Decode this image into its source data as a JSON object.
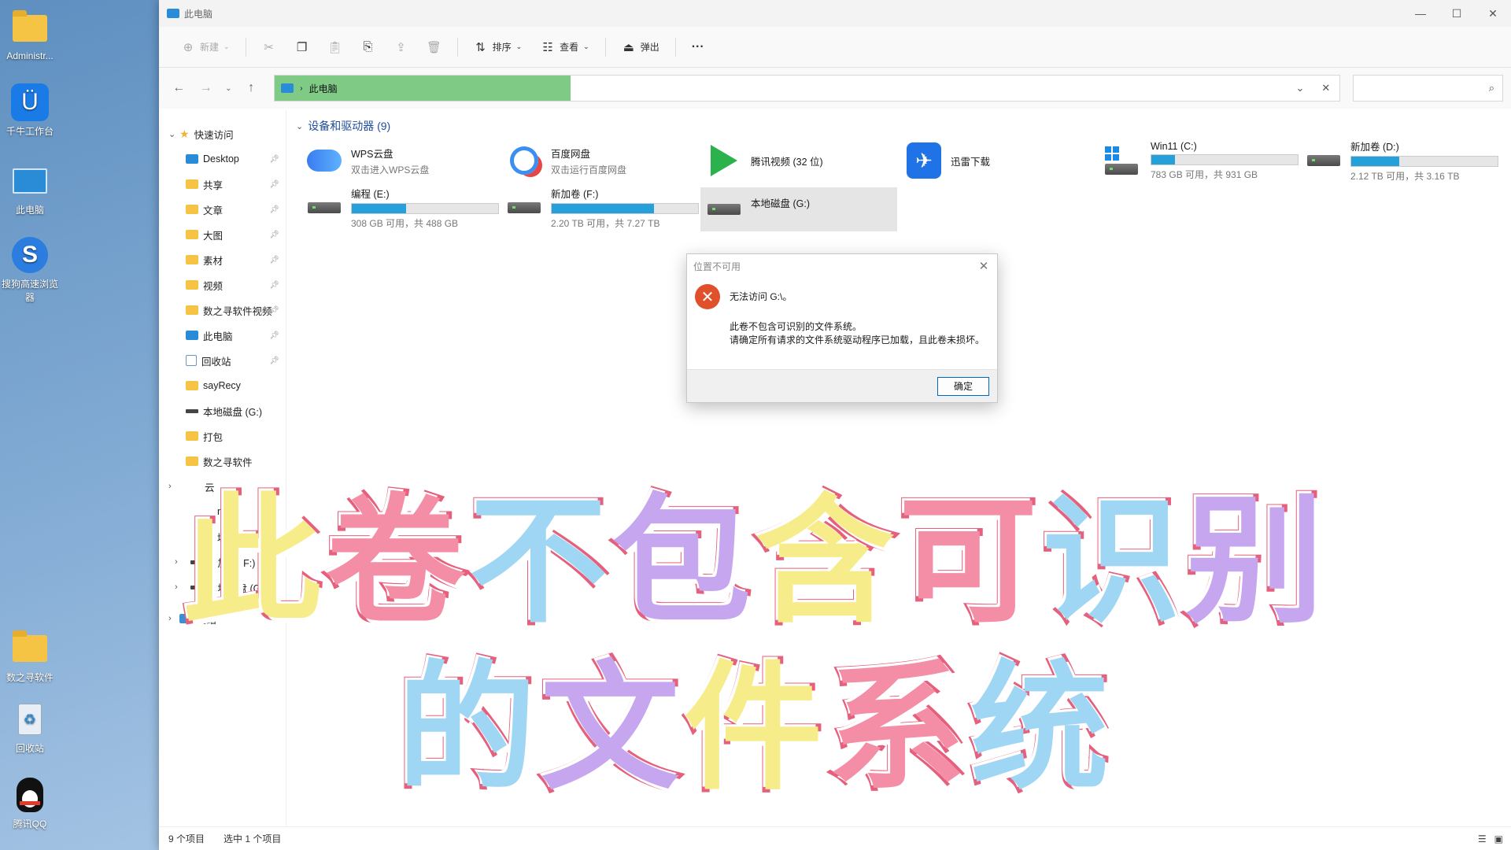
{
  "desktop": {
    "icons": [
      {
        "label": "Administr..."
      },
      {
        "label": "千牛工作台"
      },
      {
        "label": "此电脑"
      },
      {
        "label": "搜狗高速浏览器"
      },
      {
        "label": "数之寻软件"
      },
      {
        "label": "回收站"
      },
      {
        "label": "腾讯QQ"
      }
    ]
  },
  "window": {
    "title": "此电脑",
    "controls": {
      "minimize": "—",
      "maximize": "☐",
      "close": "✕"
    }
  },
  "toolbar": {
    "new": "新建",
    "sort": "排序",
    "view": "查看",
    "eject": "弹出",
    "more": "···"
  },
  "address": {
    "path": "此电脑"
  },
  "sidebar": {
    "quick_access": "快速访问",
    "items": [
      {
        "label": "Desktop"
      },
      {
        "label": "共享"
      },
      {
        "label": "文章"
      },
      {
        "label": "大图"
      },
      {
        "label": "素材"
      },
      {
        "label": "视频"
      },
      {
        "label": "数之寻软件视频"
      },
      {
        "label": "此电脑"
      },
      {
        "label": "回收站"
      },
      {
        "label": "sayRecy"
      },
      {
        "label": "本地磁盘 (G:)"
      },
      {
        "label": "打包"
      },
      {
        "label": "数之寻软件"
      }
    ],
    "partial": [
      "云",
      "n1",
      "域"
    ],
    "drives": [
      {
        "label": "新加卷 (F:)"
      },
      {
        "label": "本地磁盘 (G:)"
      }
    ],
    "network": "网络"
  },
  "content": {
    "group_title": "设备和驱动器 (9)",
    "tiles": [
      {
        "name": "WPS云盘",
        "sub": "双击进入WPS云盘"
      },
      {
        "name": "百度网盘",
        "sub": "双击运行百度网盘"
      },
      {
        "name": "腾讯视频 (32 位)"
      },
      {
        "name": "迅雷下载"
      },
      {
        "name": "Win11 (C:)",
        "sub": "783 GB 可用，共 931 GB",
        "used": 0.16
      },
      {
        "name": "新加卷 (D:)",
        "sub": "2.12 TB 可用，共 3.16 TB",
        "used": 0.33
      },
      {
        "name": "编程 (E:)",
        "sub": "308 GB 可用，共 488 GB",
        "used": 0.37
      },
      {
        "name": "新加卷 (F:)",
        "sub": "2.20 TB 可用，共 7.27 TB",
        "used": 0.7
      },
      {
        "name": "本地磁盘 (G:)"
      }
    ]
  },
  "dialog": {
    "title": "位置不可用",
    "heading": "无法访问 G:\\。",
    "line1": "此卷不包含可识别的文件系统。",
    "line2": "请确定所有请求的文件系统驱动程序已加载，且此卷未损坏。",
    "ok": "确定"
  },
  "status": {
    "count": "9 个项目",
    "selected": "选中 1 个项目"
  },
  "caption": {
    "line1": "此卷不包含可识别",
    "line2": "的文件系统",
    "colors": [
      "#f7ec8a",
      "#f48da6",
      "#9fd6f3",
      "#c6a6ef"
    ]
  }
}
